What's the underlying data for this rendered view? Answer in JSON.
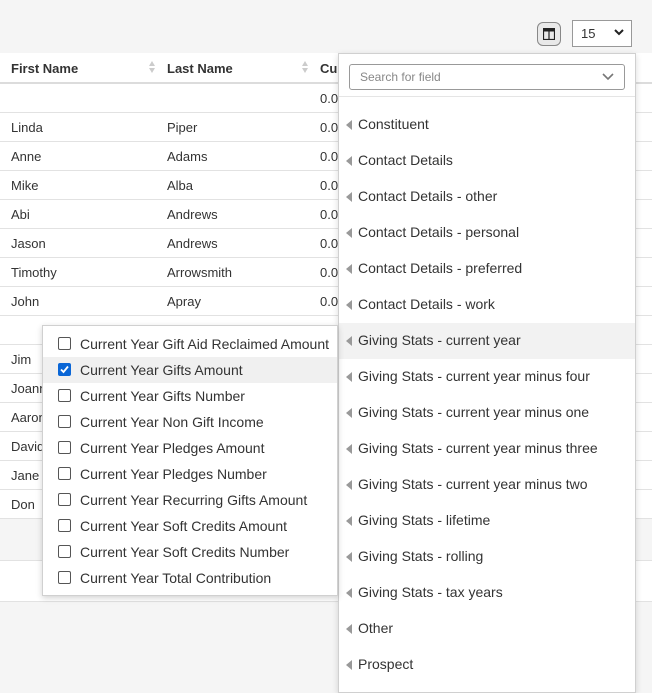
{
  "toolbar": {
    "page_size": "15"
  },
  "grid": {
    "columns": [
      "First Name",
      "Last Name",
      "Cur"
    ],
    "rows": [
      {
        "first": "",
        "last": "",
        "cur": "0.0"
      },
      {
        "first": "Linda",
        "last": "Piper",
        "cur": "0.0"
      },
      {
        "first": "Anne",
        "last": "Adams",
        "cur": "0.0"
      },
      {
        "first": "Mike",
        "last": "Alba",
        "cur": "0.0"
      },
      {
        "first": "Abi",
        "last": "Andrews",
        "cur": "0.0"
      },
      {
        "first": "Jason",
        "last": "Andrews",
        "cur": "0.0"
      },
      {
        "first": "Timothy",
        "last": "Arrowsmith",
        "cur": "0.0"
      },
      {
        "first": "John",
        "last": "Apray",
        "cur": "0.0"
      },
      {
        "first": "",
        "last": "",
        "cur": ""
      },
      {
        "first": "Jim",
        "last": "",
        "cur": ""
      },
      {
        "first": "Joann",
        "last": "",
        "cur": ""
      },
      {
        "first": "Aaron",
        "last": "",
        "cur": ""
      },
      {
        "first": "David",
        "last": "",
        "cur": ""
      },
      {
        "first": "Jane",
        "last": "",
        "cur": ""
      },
      {
        "first": "Don",
        "last": "",
        "cur": ""
      }
    ]
  },
  "field_picker": {
    "search_placeholder": "Search for field",
    "categories": [
      "Constituent",
      "Contact Details",
      "Contact Details - other",
      "Contact Details - personal",
      "Contact Details - preferred",
      "Contact Details - work",
      "Giving Stats - current year",
      "Giving Stats - current year minus four",
      "Giving Stats - current year minus one",
      "Giving Stats - current year minus three",
      "Giving Stats - current year minus two",
      "Giving Stats - lifetime",
      "Giving Stats - rolling",
      "Giving Stats - tax years",
      "Other",
      "Prospect"
    ],
    "active_category": "Giving Stats - current year"
  },
  "sub_fields": [
    {
      "label": "Current Year Gift Aid Reclaimed Amount",
      "checked": false
    },
    {
      "label": "Current Year Gifts Amount",
      "checked": true
    },
    {
      "label": "Current Year Gifts Number",
      "checked": false
    },
    {
      "label": "Current Year Non Gift Income",
      "checked": false
    },
    {
      "label": "Current Year Pledges Amount",
      "checked": false
    },
    {
      "label": "Current Year Pledges Number",
      "checked": false
    },
    {
      "label": "Current Year Recurring Gifts Amount",
      "checked": false
    },
    {
      "label": "Current Year Soft Credits Amount",
      "checked": false
    },
    {
      "label": "Current Year Soft Credits Number",
      "checked": false
    },
    {
      "label": "Current Year Total Contribution",
      "checked": false
    }
  ],
  "colors": {
    "accent": "#0a66d6",
    "active_row": "#f2f2f2"
  }
}
